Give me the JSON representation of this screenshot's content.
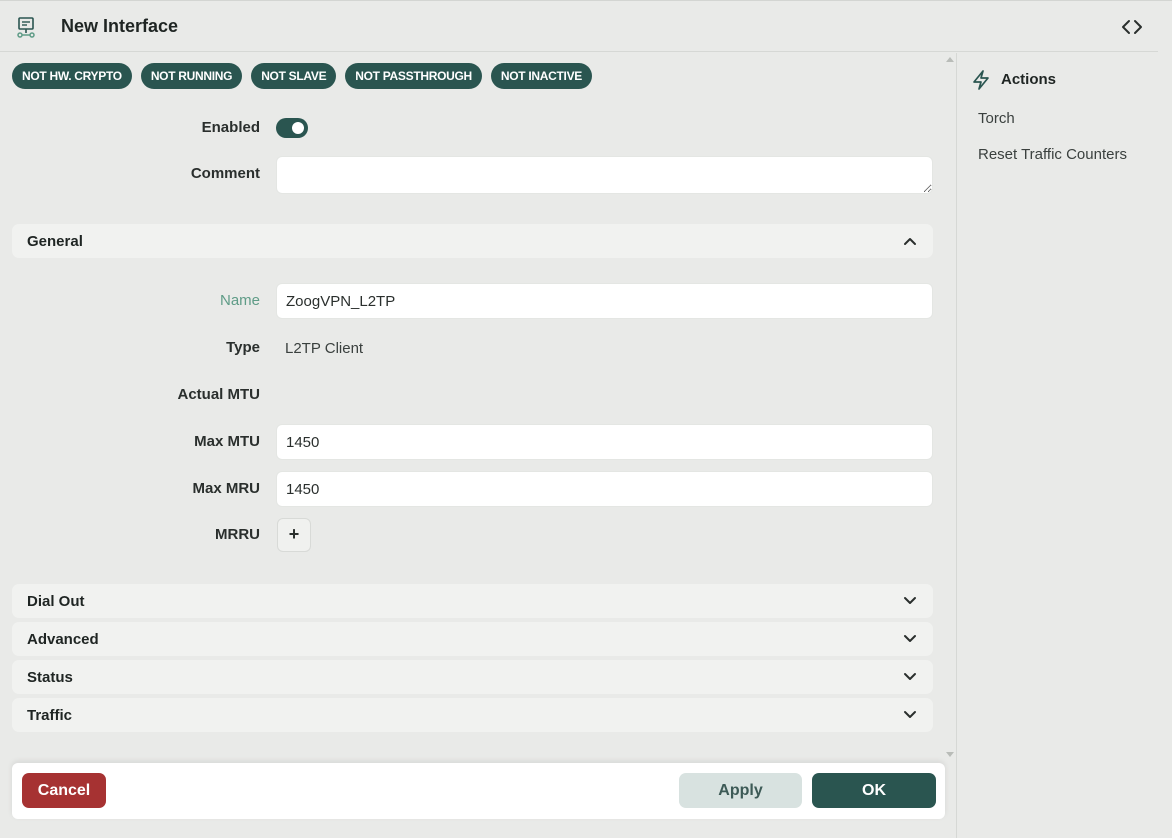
{
  "window": {
    "title": "New Interface",
    "icon": "interface-icon"
  },
  "badges": [
    "NOT HW. CRYPTO",
    "NOT RUNNING",
    "NOT SLAVE",
    "NOT PASSTHROUGH",
    "NOT INACTIVE"
  ],
  "top_fields": {
    "enabled_label": "Enabled",
    "enabled_value": true,
    "comment_label": "Comment",
    "comment_value": ""
  },
  "general": {
    "title": "General",
    "expanded": true,
    "name_label": "Name",
    "name_value": "ZoogVPN_L2TP",
    "type_label": "Type",
    "type_value": "L2TP Client",
    "actual_mtu_label": "Actual MTU",
    "max_mtu_label": "Max MTU",
    "max_mtu_value": "1450",
    "max_mru_label": "Max MRU",
    "max_mru_value": "1450",
    "mrru_label": "MRRU",
    "mrru_add": "+"
  },
  "sections": [
    {
      "title": "Dial Out",
      "expanded": false
    },
    {
      "title": "Advanced",
      "expanded": false
    },
    {
      "title": "Status",
      "expanded": false
    },
    {
      "title": "Traffic",
      "expanded": false
    }
  ],
  "actions": {
    "title": "Actions",
    "items": [
      "Torch",
      "Reset Traffic Counters"
    ]
  },
  "footer": {
    "cancel_label": "Cancel",
    "apply_label": "Apply",
    "ok_label": "OK"
  },
  "colors": {
    "accent": "#2a5550",
    "danger": "#a63232",
    "label_accent": "#5f9c87",
    "background": "#e9eae8"
  }
}
